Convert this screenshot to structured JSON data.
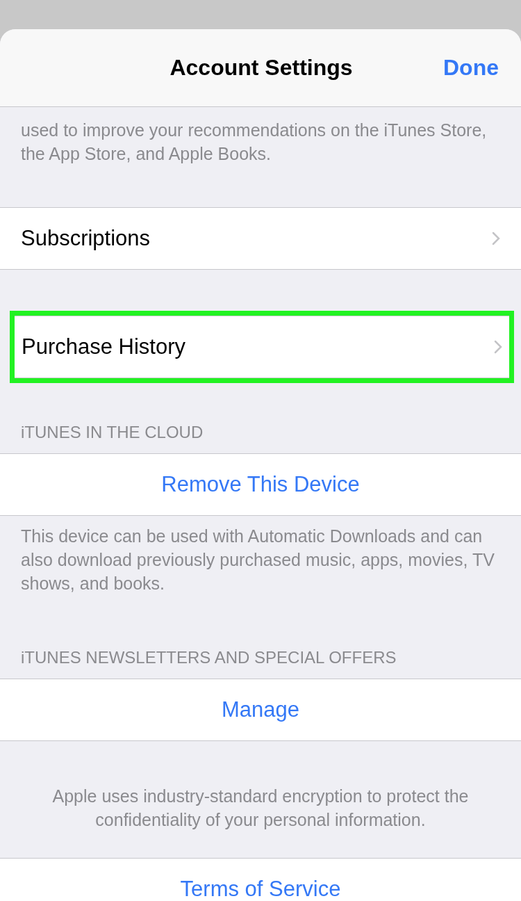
{
  "sheet": {
    "title": "Account Settings",
    "done_button": "Done"
  },
  "sections": [
    {
      "kind": "footer",
      "text": "used to improve your recommendations on the iTunes Store, the App Store, and Apple Books."
    },
    {
      "kind": "row",
      "label": "Subscriptions",
      "highlighted": false
    },
    {
      "kind": "row",
      "label": "Purchase History",
      "highlighted": true
    },
    {
      "kind": "header",
      "text": "iTUNES IN THE CLOUD"
    },
    {
      "kind": "action",
      "label": "Remove This Device"
    },
    {
      "kind": "footer",
      "text": "This device can be used with Automatic Downloads and can also download previously purchased music, apps, movies, TV shows, and books."
    },
    {
      "kind": "header",
      "text": "iTUNES NEWSLETTERS AND SPECIAL OFFERS"
    },
    {
      "kind": "action",
      "label": "Manage"
    },
    {
      "kind": "note",
      "text": "Apple uses industry-standard encryption to protect the confidentiality of your personal information."
    },
    {
      "kind": "action",
      "label": "Terms of Service"
    }
  ]
}
